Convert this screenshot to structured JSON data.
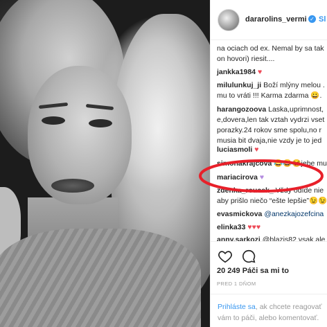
{
  "header": {
    "username": "dararolins_vermi",
    "follow_label": "Sl"
  },
  "comments": [
    {
      "user": "",
      "text": "na ociach od ex. Nemal by sa tak"
    },
    {
      "user": "",
      "text": "on hovori) riesit...."
    },
    {
      "user": "jankka1984",
      "text": "",
      "icon": "red-heart"
    },
    {
      "user": "milulunkuj_ji",
      "text": "Boží mlýny melou ."
    },
    {
      "user": "",
      "text": "mu to vráti !!! Karma zdarma 😀."
    },
    {
      "user": "harangozoova",
      "text": "Laska,uprimnost,"
    },
    {
      "user": "",
      "text": "e,dovera,len tak vztah vydrzi vset"
    },
    {
      "user": "",
      "text": "porazky.24 rokov sme spolu,no r"
    },
    {
      "user": "",
      "text": "musia bit dvaja,nie vzdy je to jed"
    },
    {
      "user": "luciasmoli",
      "text": "",
      "icon": "red-heart"
    },
    {
      "user": "simonakrajcova",
      "text": "😂😂😂jebe mu."
    },
    {
      "user": "mariacirova",
      "text": "",
      "icon": "purple-heart"
    },
    {
      "user": "zdenka_roucek_",
      "text": "Vždy odíde nie"
    },
    {
      "user": "",
      "text": "aby prišlo niečo “ešte lepšie”😉😉"
    },
    {
      "user": "evasmickova",
      "text": "@anezkajozefcina"
    },
    {
      "user": "elinka33",
      "text": "",
      "icon": "three-red-hearts"
    },
    {
      "user": "anny.sarkozi",
      "text": "@blazis82 vsak ale"
    }
  ],
  "actions": {
    "likes": "20 249 Páči sa mi to",
    "time": "PRED 1 DŇOM"
  },
  "footer": {
    "login": "Prihláste sa",
    "line1_rest": ", ak chcete reagovať",
    "line2": "vám to páči, alebo komentovať."
  },
  "colors": {
    "accent": "#3897f0",
    "heart": "#ed4956",
    "purple_heart": "#b38bdf",
    "annotation": "#e8202a"
  }
}
